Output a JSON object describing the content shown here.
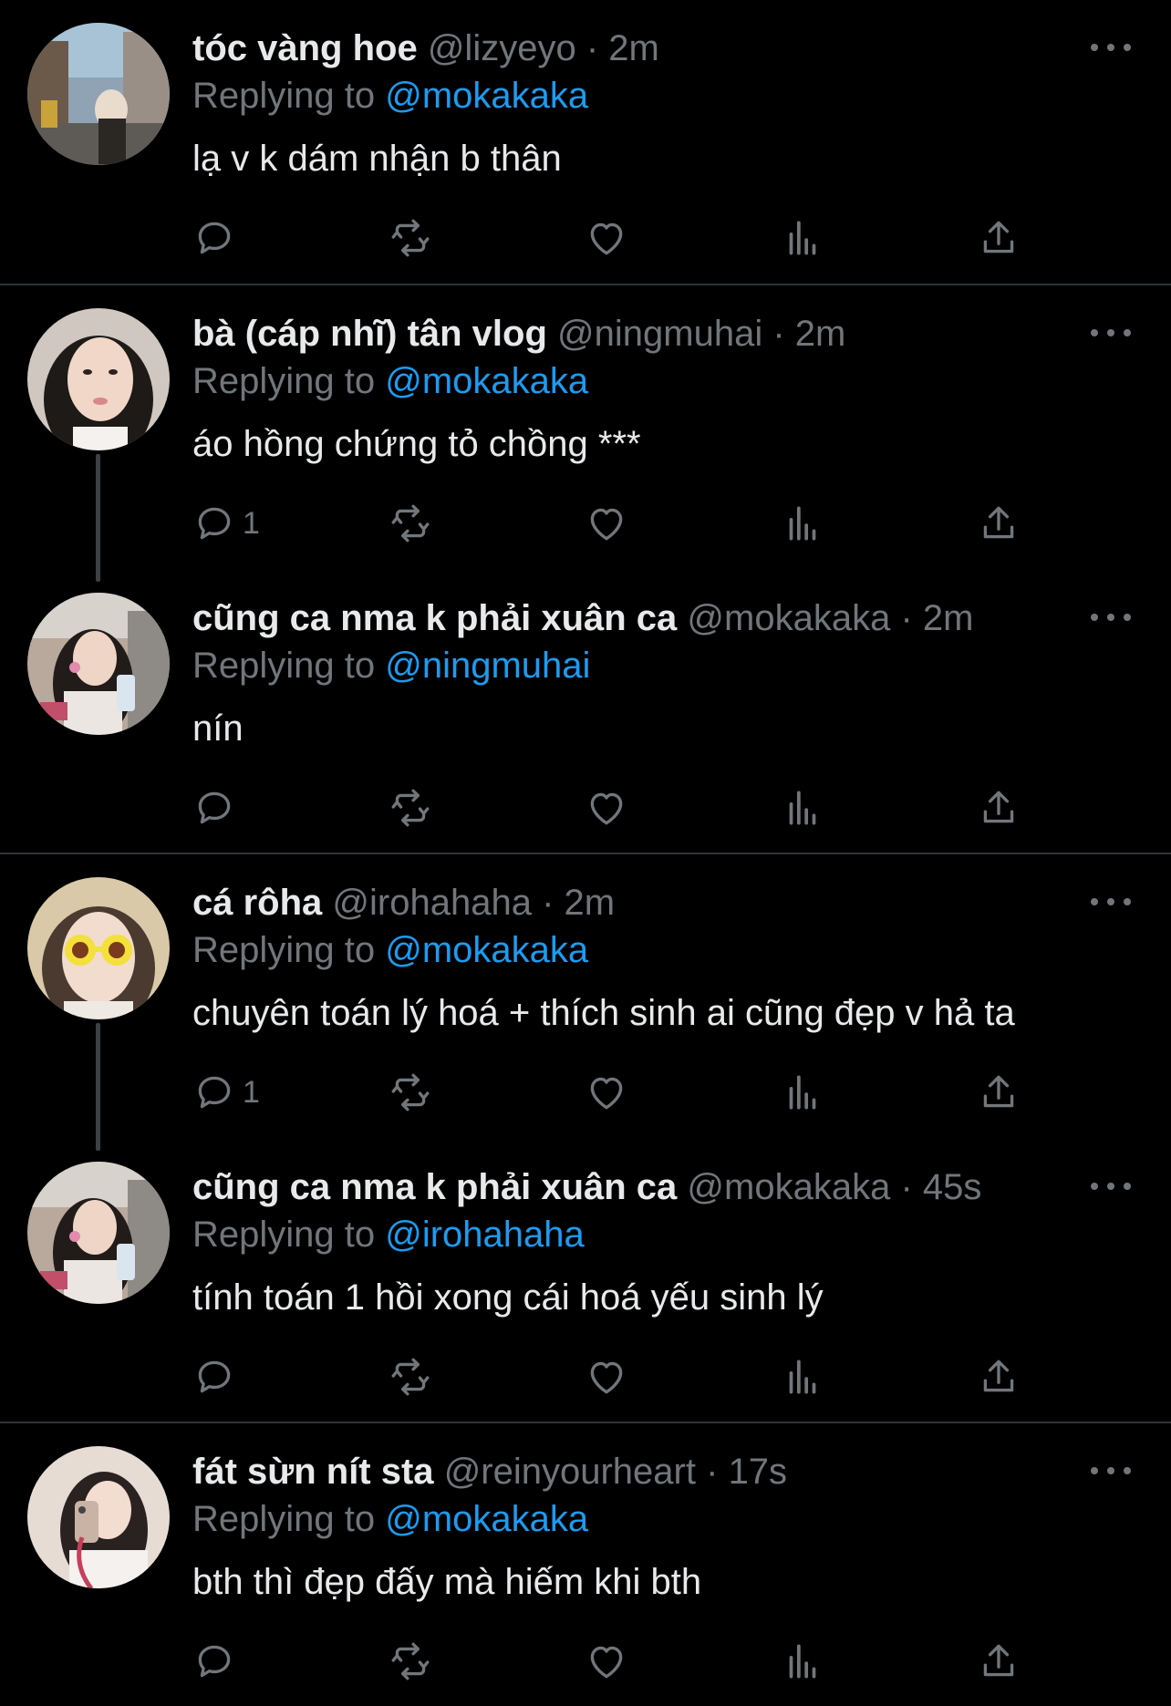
{
  "tweets": [
    {
      "name": "tóc vàng hoe",
      "handle": "@lizyeyo",
      "dot": "·",
      "time": "2m",
      "replying_prefix": "Replying to ",
      "replying_to": "@mokakaka",
      "text": "lạ v k dám nhận b thân",
      "reply_count": ""
    },
    {
      "name": "bà (cáp nhĩ) tân vlog",
      "handle": "@ningmuhai",
      "dot": "·",
      "time": "2m",
      "replying_prefix": "Replying to ",
      "replying_to": "@mokakaka",
      "text": "áo hồng chứng tỏ chồng ***",
      "reply_count": "1"
    },
    {
      "name": "cũng ca nma k phải xuân ca",
      "handle": "@mokakaka",
      "dot": "·",
      "time": "2m",
      "replying_prefix": "Replying to ",
      "replying_to": "@ningmuhai",
      "text": "nín",
      "reply_count": ""
    },
    {
      "name": "cá rôha",
      "handle": "@irohahaha",
      "dot": "·",
      "time": "2m",
      "replying_prefix": "Replying to ",
      "replying_to": "@mokakaka",
      "text": "chuyên toán lý hoá + thích sinh ai cũng đẹp v hả ta",
      "reply_count": "1"
    },
    {
      "name": "cũng ca nma k phải xuân ca",
      "handle": "@mokakaka",
      "dot": "·",
      "time": "45s",
      "replying_prefix": "Replying to ",
      "replying_to": "@irohahaha",
      "text": "tính toán 1 hồi xong cái hoá yếu sinh lý",
      "reply_count": ""
    },
    {
      "name": "fát sừn nít sta",
      "handle": "@reinyourheart",
      "dot": "·",
      "time": "17s",
      "replying_prefix": "Replying to ",
      "replying_to": "@mokakaka",
      "text": "bth thì đẹp đấy mà hiếm khi bth",
      "reply_count": ""
    }
  ],
  "icons": {
    "more": "more-horizontal-icon",
    "reply": "reply-bubble-icon",
    "retweet": "retweet-icon",
    "like": "heart-icon",
    "views": "views-chart-icon",
    "share": "share-upload-icon"
  },
  "colors": {
    "background": "#000000",
    "text": "#e7e9ea",
    "muted": "#71767b",
    "link": "#1d9bf0",
    "divider": "#2f3336",
    "thread_line": "#3d4145"
  }
}
